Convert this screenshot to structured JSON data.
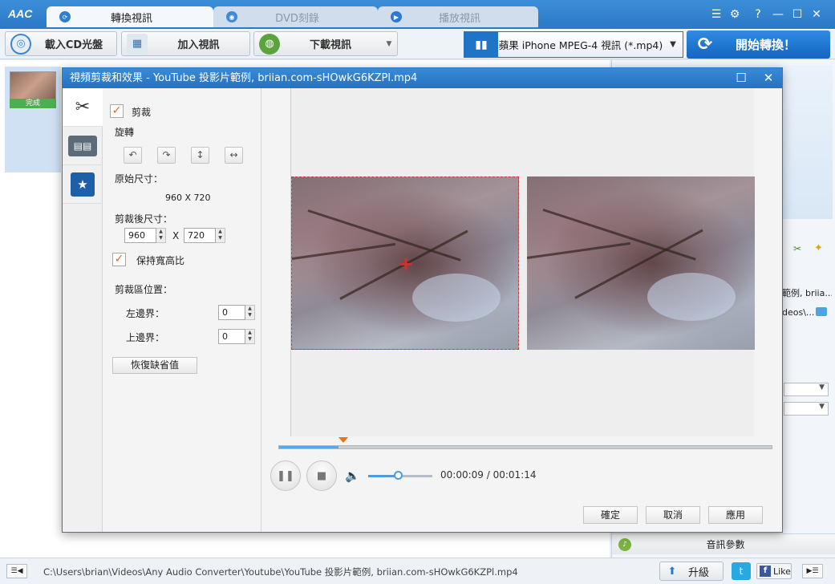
{
  "app": {
    "logo": "AAC",
    "tabs": [
      {
        "label": "轉換視訊",
        "active": true
      },
      {
        "label": "DVD刻錄",
        "active": false
      },
      {
        "label": "播放視訊",
        "active": false
      }
    ]
  },
  "toolbar": {
    "load_cd": "載入CD光盤",
    "add_video": "加入視訊",
    "download_video": "下載視訊",
    "format": "蘋果 iPhone MPEG-4 視訊 (*.mp4)",
    "convert": "開始轉換！"
  },
  "file_list": {
    "items": [
      {
        "status": "完成"
      }
    ]
  },
  "right_panel": {
    "rows": [
      "範例, briia...",
      "deos\\..."
    ],
    "audio_params": "音訊參數"
  },
  "dialog": {
    "title": "視頻剪裁和效果 - YouTube 投影片範例, briian.com-sHOwkG6KZPl.mp4",
    "crop_checkbox": {
      "label": "剪裁",
      "checked": true
    },
    "rotate_label": "旋轉",
    "original_size_label": "原始尺寸：",
    "original_size_value": "960 X 720",
    "cropped_size_label": "剪裁後尺寸：",
    "crop_width": "960",
    "crop_height": "720",
    "size_separator": "X",
    "keep_aspect": {
      "label": "保持寬高比",
      "checked": true
    },
    "crop_position_label": "剪裁區位置：",
    "left_margin_label": "左邊界：",
    "left_margin_value": "0",
    "top_margin_label": "上邊界：",
    "top_margin_value": "0",
    "reset_button": "恢復缺省值",
    "time_readout": "00:00:09 / 00:01:14",
    "playback_progress": 0.12,
    "volume_level": 0.48,
    "buttons": {
      "ok": "確定",
      "cancel": "取消",
      "apply": "應用"
    }
  },
  "status": {
    "path": "C:\\Users\\brian\\Videos\\Any Audio Converter\\Youtube\\YouTube 投影片範例, briian.com-sHOwkG6KZPl.mp4",
    "upgrade": "升級",
    "like": "Like"
  }
}
